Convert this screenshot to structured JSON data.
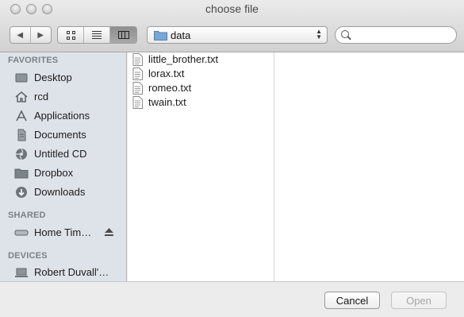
{
  "window": {
    "title": "choose file"
  },
  "toolbar": {
    "back_icon": "◀",
    "forward_icon": "▶",
    "view_modes": [
      "icon-view",
      "list-view",
      "column-view"
    ],
    "active_view": "column-view",
    "location": "data",
    "search_placeholder": ""
  },
  "sidebar": {
    "favorites_header": "FAVORITES",
    "favorites": [
      {
        "label": "Desktop",
        "icon": "desktop-icon"
      },
      {
        "label": "rcd",
        "icon": "home-icon"
      },
      {
        "label": "Applications",
        "icon": "applications-icon"
      },
      {
        "label": "Documents",
        "icon": "documents-icon"
      },
      {
        "label": "Untitled CD",
        "icon": "cd-icon"
      },
      {
        "label": "Dropbox",
        "icon": "folder-icon"
      },
      {
        "label": "Downloads",
        "icon": "downloads-icon"
      }
    ],
    "shared_header": "SHARED",
    "shared": [
      {
        "label": "Home Tim…",
        "icon": "network-drive-icon"
      }
    ],
    "devices_header": "DEVICES",
    "devices": [
      {
        "label": "Robert Duvall'…",
        "icon": "computer-icon"
      }
    ]
  },
  "files": [
    {
      "name": "little_brother.txt"
    },
    {
      "name": "lorax.txt"
    },
    {
      "name": "romeo.txt"
    },
    {
      "name": "twain.txt"
    }
  ],
  "buttons": {
    "cancel": "Cancel",
    "open": "Open"
  },
  "colors": {
    "sidebar_bg": "#dee3ea",
    "section_header": "#7b8189",
    "disabled_text": "#a5a5a5"
  }
}
